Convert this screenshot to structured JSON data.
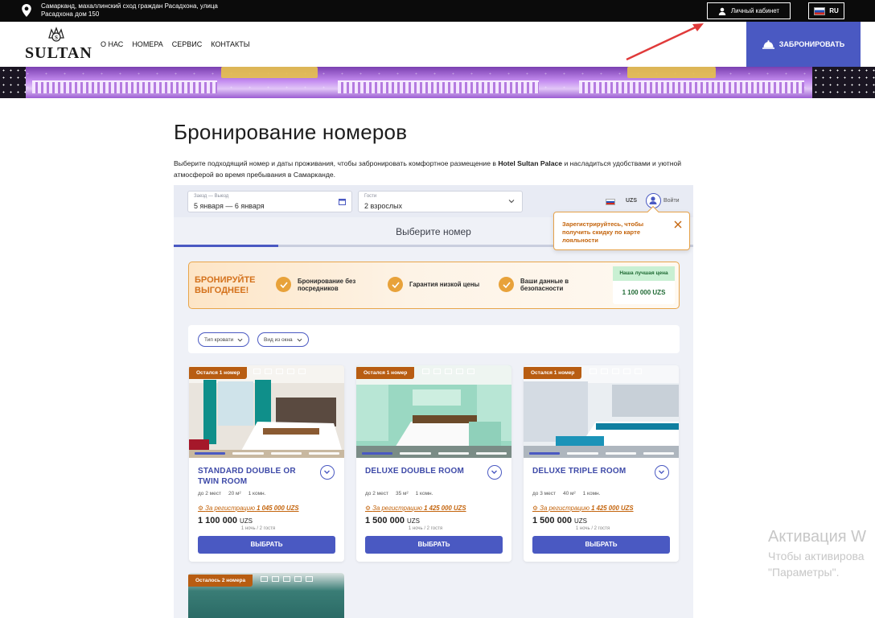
{
  "topbar": {
    "address_line1": "Самарканд, махаллинский сход граждан Расадхона, улица",
    "address_line2": "Расадхона дом 150",
    "cabinet_label": "Личный кабинет",
    "lang_label": "RU"
  },
  "nav": {
    "logo_text": "SULTAN",
    "menu": [
      "О НАС",
      "НОМЕРА",
      "СЕРВИС",
      "КОНТАКТЫ"
    ],
    "book_label": "ЗАБРОНИРОВАТЬ"
  },
  "page": {
    "title": "Бронирование номеров",
    "intro_pre": "Выберите подходящий номер и даты проживания, чтобы забронировать комфортное размещение в ",
    "intro_hotel": "Hotel Sultan Palace",
    "intro_post": " и насладиться удобствами и уютной атмосферой во время пребывания в Самарканде."
  },
  "widget": {
    "dates_label": "Заезд — Выезд",
    "dates_value": "5 января — 6 января",
    "guests_label": "Гости",
    "guests_value": "2 взрослых",
    "currency": "UZS",
    "login_label": "Войти",
    "tab_label": "Выберите номер",
    "tooltip": "Зарегистрируйтесь, чтобы получить скидку по карте лояльности"
  },
  "promo": {
    "headline": "БРОНИРУЙТЕ ВЫГОДНЕЕ!",
    "items": [
      "Бронирование без посредников",
      "Гарантия низкой цены",
      "Ваши данные в безопасности"
    ],
    "best_tag": "Наша лучшая цена",
    "best_price": "1 100 000 UZS"
  },
  "filters": [
    "Тип кровати",
    "Вид из окна"
  ],
  "rooms": [
    {
      "badge": "Остался 1 номер",
      "name": "STANDARD DOUBLE OR TWIN ROOM",
      "guests": "до 2 мест",
      "area": "20 м²",
      "rooms": "1 комн.",
      "reg_prefix": "За регистрацию",
      "reg_price": "1 045 000 UZS",
      "price": "1 100 000",
      "currency": "UZS",
      "per": "1 ночь / 2 гостя",
      "select": "ВЫБРАТЬ"
    },
    {
      "badge": "Остался 1 номер",
      "name": "DELUXE DOUBLE ROOM",
      "guests": "до 2 мест",
      "area": "35 м²",
      "rooms": "1 комн.",
      "reg_prefix": "За регистрацию",
      "reg_price": "1 425 000 UZS",
      "price": "1 500 000",
      "currency": "UZS",
      "per": "1 ночь / 2 гостя",
      "select": "ВЫБРАТЬ"
    },
    {
      "badge": "Остался 1 номер",
      "name": "DELUXE TRIPLE ROOM",
      "guests": "до 3 мест",
      "area": "40 м²",
      "rooms": "1 комн.",
      "reg_prefix": "За регистрацию",
      "reg_price": "1 425 000 UZS",
      "price": "1 500 000",
      "currency": "UZS",
      "per": "1 ночь / 2 гостя",
      "select": "ВЫБРАТЬ"
    },
    {
      "badge": "Осталось 2 номера"
    }
  ],
  "watermark": {
    "line1": "Активация W",
    "line2": "Чтобы активирова",
    "line3": "\"Параметры\"."
  },
  "colors": {
    "accent": "#4a59c2",
    "promo_orange": "#d4711b",
    "badge_brown": "#b85d12",
    "topbar_black": "#0b0b0b"
  },
  "icons": [
    "map-pin-icon",
    "user-icon",
    "ru-flag-icon",
    "bell-icon",
    "calendar-icon",
    "chevron-down-icon",
    "close-icon",
    "check-icon",
    "medal-icon"
  ]
}
